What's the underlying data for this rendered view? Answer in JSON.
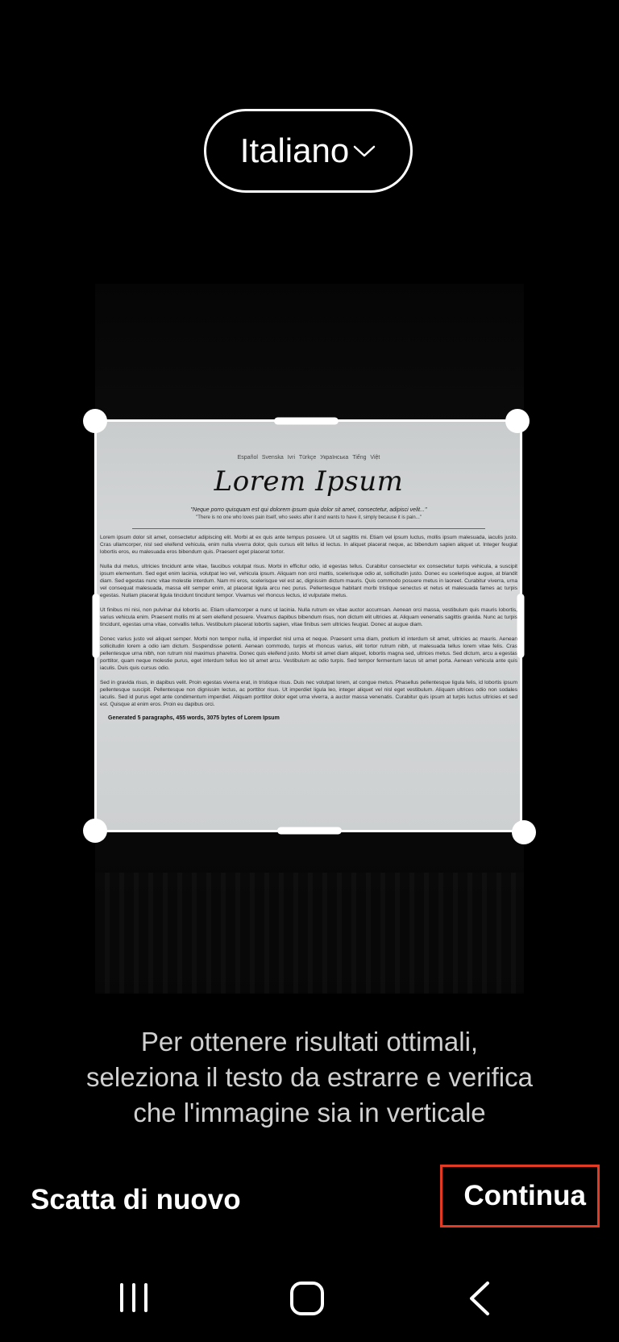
{
  "language_selector": {
    "label": "Italiano",
    "icon": "chevron-down-icon"
  },
  "document": {
    "languages": [
      "Español",
      "Svenska",
      "Ivri",
      "Türkçe",
      "Українська",
      "Tiếng Việt"
    ],
    "title": "Lorem Ipsum",
    "quote": "\"Neque porro quisquam est qui dolorem ipsum quia dolor sit amet, consectetur, adipisci velit...\"",
    "quote_translation": "\"There is no one who loves pain itself, who seeks after it and wants to have it, simply because it is pain...\"",
    "paragraphs": [
      "Lorem ipsum dolor sit amet, consectetur adipiscing elit. Morbi at ex quis ante tempus posuere. Ut ut sagittis mi. Etiam vel ipsum luctus, mollis ipsum malesuada, iaculis justo. Cras ullamcorper, nisl sed eleifend vehicula, enim nulla viverra dolor, quis cursus elit tellus id lectus. In aliquet placerat neque, ac bibendum sapien aliquet ut. Integer feugiat lobortis eros, eu malesuada eros bibendum quis. Praesent eget placerat tortor.",
      "Nulla dui metus, ultricies tincidunt ante vitae, faucibus volutpat risus. Morbi in efficitur odio, id egestas tellus. Curabitur consectetur ex consectetur turpis vehicula, a suscipit ipsum elementum. Sed eget enim lacinia, volutpat leo vel, vehicula ipsum. Aliquam non orci mattis, scelerisque odio at, sollicitudin justo. Donec eu scelerisque augue, at blandit diam. Sed egestas nunc vitae molestie interdum. Nam mi eros, scelerisque vel est ac, dignissim dictum mauris. Quis commodo posuere metus in laoreet. Curabitur viverra, urna vel consequat malesuada, massa elit semper enim, at placerat ligula arcu nec purus. Pellentesque habitant morbi tristique senectus et netus et malesuada fames ac turpis egestas. Nullam placerat ligula tincidunt tincidunt tempor. Vivamus vel rhoncus lectus, id vulputate metus.",
      "Ut finibus mi nisi, non pulvinar dui lobortis ac. Etiam ullamcorper a nunc ut lacinia. Nulla rutrum ex vitae auctor accumsan. Aenean orci massa, vestibulum quis mauris lobortis, varius vehicula enim. Praesent mollis mi at sem eleifend posuere. Vivamus dapibus bibendum risus, non dictum elit ultricies at. Aliquam venenatis sagittis gravida. Nunc ac turpis tincidunt, egestas urna vitae, convallis tellus. Vestibulum placerat lobortis sapien, vitae finibus sem ultricies feugiat. Donec at augue diam.",
      "Donec varius justo vel aliquet semper. Morbi non tempor nulla, id imperdiet nisl urna et neque. Praesent urna diam, pretium id interdum sit amet, ultricies ac mauris. Aenean sollicitudin lorem a odio iam dictum. Suspendisse potenti. Aenean commodo, turpis et rhoncus varius, elit tortor rutrum nibh, ut malesuada tellus lorem vitae felis. Cras pellentesque urna nibh, non rutrum nisl maximus pharetra. Donec quis eleifend justo. Morbi sit amet diam aliquet, lobortis magna sed, ultrices metus. Sed dictum, arcu a egestas porttitor, quam neque molestie purus, eget interdum tellus leo sit amet arcu. Vestibulum ac odio turpis. Sed tempor fermentum lacus sit amet porta. Aenean vehicula ante quis iaculis. Duis quis cursus odio.",
      "Sed in gravida risus, in dapibus velit. Proin egestas viverra erat, in tristique risus. Duis nec volutpat lorem, at congue metus. Phasellus pellentesque ligula felis, id lobortis ipsum pellentesque suscipit. Pellentesque non dignissim lectus, ac porttitor risus. Ut imperdiet ligula leo, integer aliquet vel nisl eget vestibulum. Aliquam ultrices odio non sodales iaculis. Sed id purus eget ante condimentum imperdiet. Aliquam porttitor dolor eget urna viverra, a auctor massa venenatis. Curabitur quis ipsum at turpis luctus ultricies et sed est. Quisque at enim eros. Proin eu dapibus orci."
    ],
    "footer": "Generated 5 paragraphs, 455 words, 3075 bytes of Lorem Ipsum"
  },
  "instruction": {
    "line1": "Per ottenere risultati ottimali,",
    "line2": "seleziona il testo da estrarre e verifica",
    "line3": "che l'immagine sia in verticale"
  },
  "actions": {
    "retake_label": "Scatta di nuovo",
    "continue_label": "Continua",
    "highlight_color": "#e23a23"
  },
  "navigation": {
    "recent_icon": "recent-apps-icon",
    "home_icon": "home-icon",
    "back_icon": "back-icon"
  }
}
